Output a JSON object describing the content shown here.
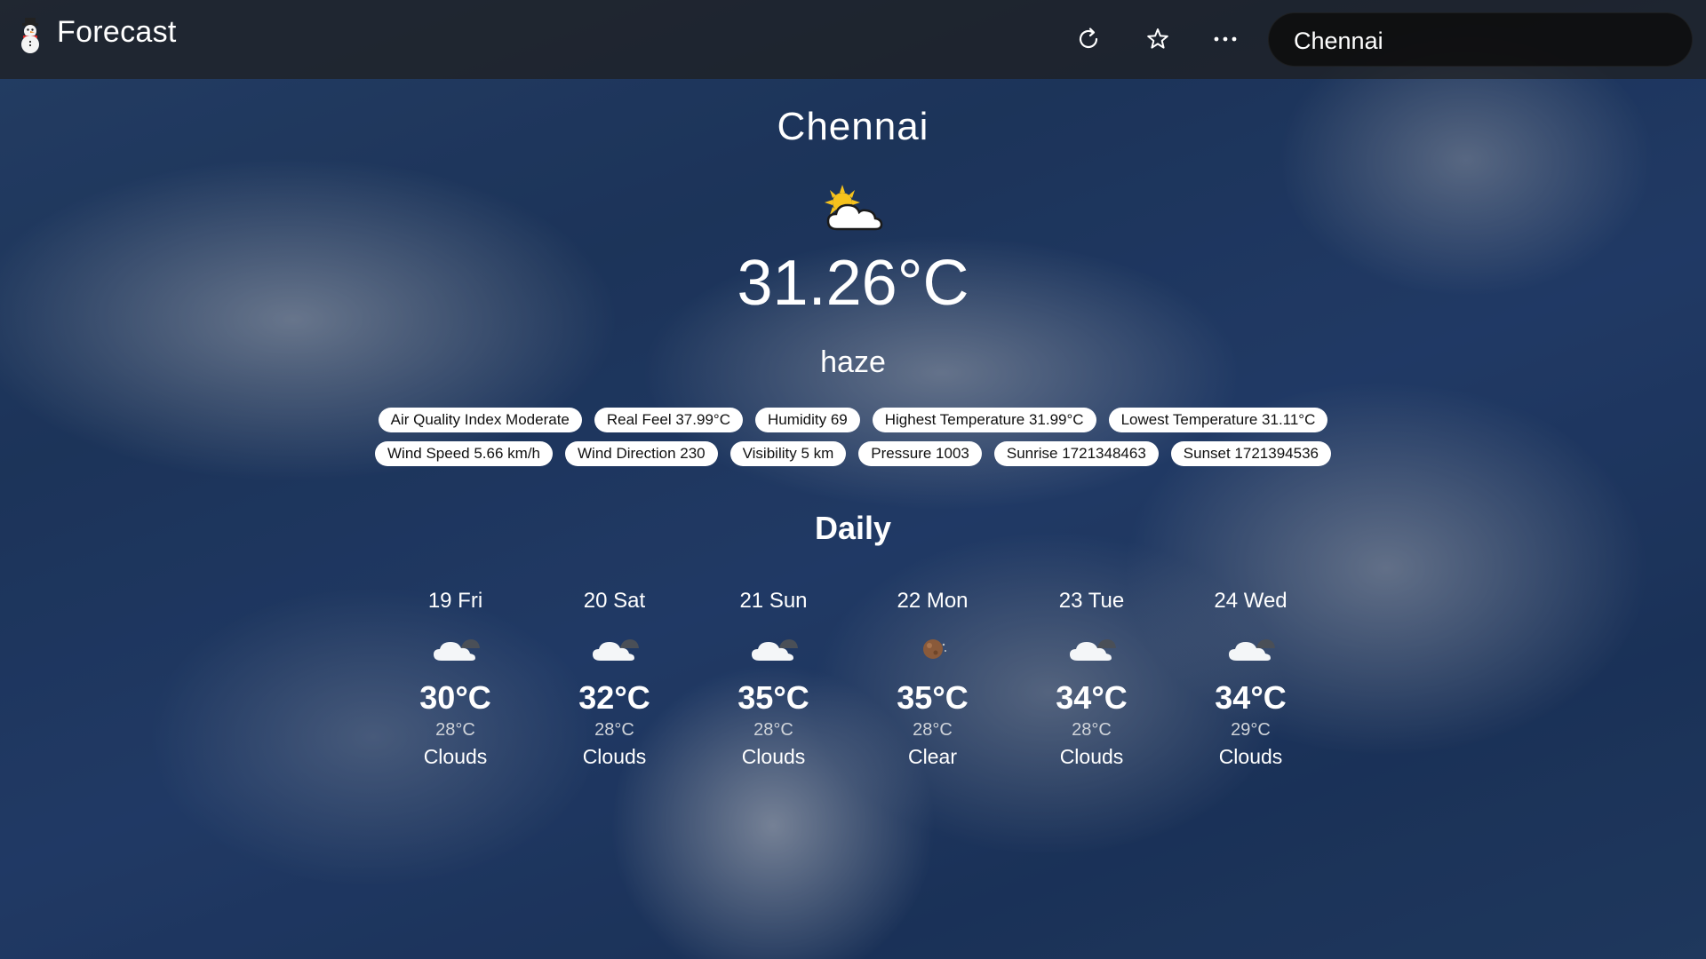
{
  "app": {
    "title": "Forecast",
    "icon": "snowman-icon"
  },
  "toolbar": {
    "refresh_icon": "refresh-icon",
    "favorite_icon": "star-icon",
    "more_icon": "more-horizontal-icon",
    "search_value": "Chennai"
  },
  "current": {
    "city": "Chennai",
    "icon": "sun-behind-cloud-icon",
    "temperature": "31.26°C",
    "condition": "haze"
  },
  "details": {
    "row1": [
      "Air Quality Index Moderate",
      "Real Feel 37.99°C",
      "Humidity 69",
      "Highest Temperature 31.99°C",
      "Lowest Temperature 31.11°C"
    ],
    "row2": [
      "Wind Speed 5.66 km/h",
      "Wind Direction 230",
      "Visibility 5 km",
      "Pressure 1003",
      "Sunrise 1721348463",
      "Sunset 1721394536"
    ]
  },
  "daily": {
    "title": "Daily",
    "days": [
      {
        "date": "19 Fri",
        "icon": "cloudy-night-icon",
        "high": "30°C",
        "low": "28°C",
        "condition": "Clouds"
      },
      {
        "date": "20 Sat",
        "icon": "cloudy-night-icon",
        "high": "32°C",
        "low": "28°C",
        "condition": "Clouds"
      },
      {
        "date": "21 Sun",
        "icon": "cloudy-night-icon",
        "high": "35°C",
        "low": "28°C",
        "condition": "Clouds"
      },
      {
        "date": "22 Mon",
        "icon": "moon-icon",
        "high": "35°C",
        "low": "28°C",
        "condition": "Clear"
      },
      {
        "date": "23 Tue",
        "icon": "cloudy-night-icon",
        "high": "34°C",
        "low": "28°C",
        "condition": "Clouds"
      },
      {
        "date": "24 Wed",
        "icon": "cloudy-night-icon",
        "high": "34°C",
        "low": "29°C",
        "condition": "Clouds"
      }
    ]
  },
  "colors": {
    "topbar": "#1e1e1e",
    "search_bg": "#0e0e0e",
    "chip_bg": "#ffffff",
    "chip_text": "#111111",
    "sky": "#23436f"
  }
}
